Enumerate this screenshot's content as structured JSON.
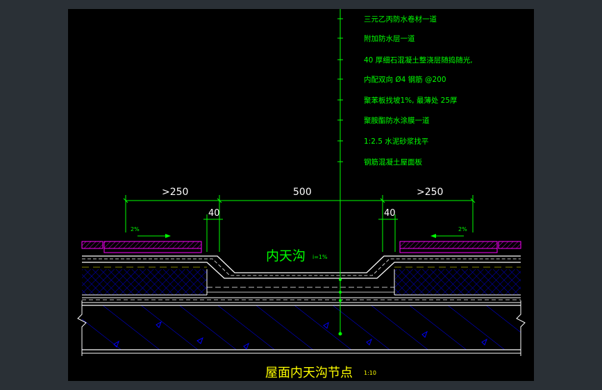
{
  "drawing": {
    "title": "屋面内天沟节点",
    "scale": "1:10",
    "gutter_label": "内天沟",
    "gutter_slope": "i=1%",
    "dims": {
      "left_overlap": ">250",
      "center_width": "500",
      "right_overlap": ">250",
      "left_offset": "40",
      "right_offset": "40"
    },
    "slope_left": "2%",
    "slope_right": "2%",
    "layers": [
      "三元乙丙防水卷材一道",
      "附加防水层一道",
      "40 厚细石混凝土整浇层随捣随光,",
      "内配双向 Ø4 钢筋 @200",
      "聚苯板找坡1%, 最薄处 25厚",
      "聚胺酯防水涂膜一道",
      "1:2.5 水泥砂浆找平",
      "钢筋混凝土屋面板"
    ]
  },
  "colors": {
    "background": "#000000",
    "leader": "#00ff00",
    "text_green": "#00ff00",
    "text_yellow": "#ffff00",
    "hatch_blue": "#0000ff",
    "magenta": "#ff00ff",
    "white": "#ffffff",
    "frame": "#2a3036"
  }
}
